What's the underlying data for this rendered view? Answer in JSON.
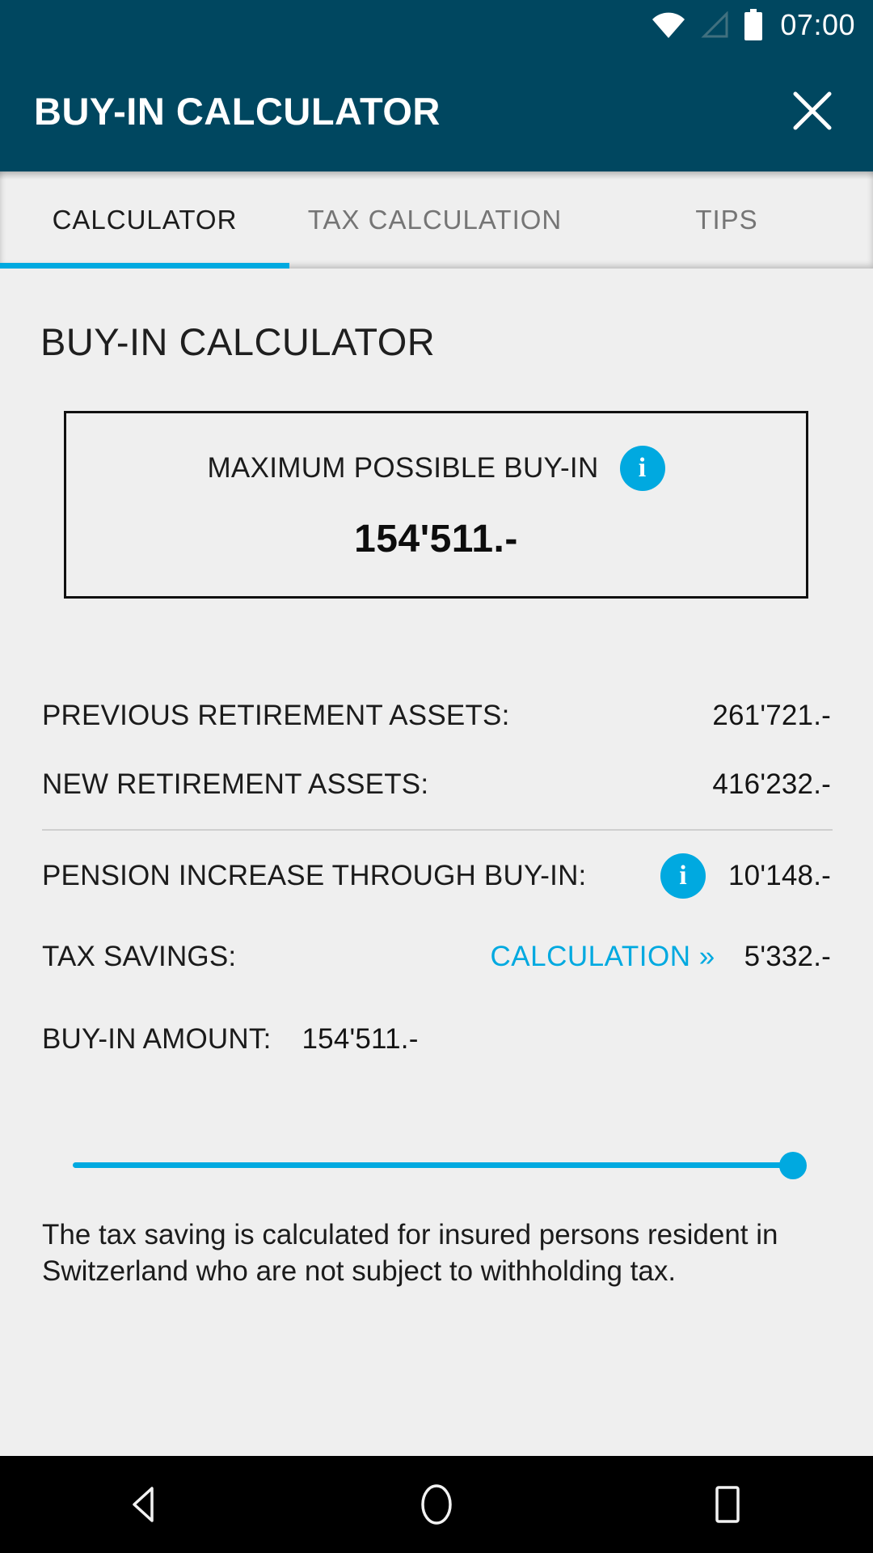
{
  "statusbar": {
    "time": "07:00",
    "icons": [
      "wifi-icon",
      "cellular-signal-icon",
      "battery-icon"
    ]
  },
  "appbar": {
    "title": "BUY-IN CALCULATOR",
    "close_label": "close-icon"
  },
  "tabs": [
    {
      "label": "CALCULATOR",
      "active": true
    },
    {
      "label": "TAX CALCULATION",
      "active": false
    },
    {
      "label": "TIPS",
      "active": false
    }
  ],
  "content": {
    "page_title": "BUY-IN CALCULATOR",
    "max_box": {
      "label": "MAXIMUM POSSIBLE BUY-IN",
      "info": "i",
      "value": "154'511.-"
    },
    "rows": [
      {
        "label": "PREVIOUS RETIREMENT ASSETS:",
        "value": "261'721.-"
      },
      {
        "label": "NEW RETIREMENT ASSETS:",
        "value": "416'232.-"
      },
      {
        "label": "PENSION INCREASE THROUGH BUY-IN:",
        "info": "i",
        "value": "10'148.-"
      },
      {
        "label": "TAX SAVINGS:",
        "link": "CALCULATION »",
        "value": "5'332.-"
      },
      {
        "label": "BUY-IN AMOUNT:",
        "value": "154'511.-"
      }
    ],
    "slider": {
      "value": "154'511.-",
      "percent": 100
    },
    "footnote": "The tax saving is calculated for insured persons resident in Switzerland who are not subject to withholding tax."
  },
  "navbar": {
    "back": "back-triangle-icon",
    "home": "home-circle-icon",
    "recents": "recents-square-icon"
  },
  "colors": {
    "appbar_bg": "#004760",
    "accent_cyan": "#00a9e0",
    "page_bg": "#efefef",
    "navbar_bg": "#000000"
  }
}
